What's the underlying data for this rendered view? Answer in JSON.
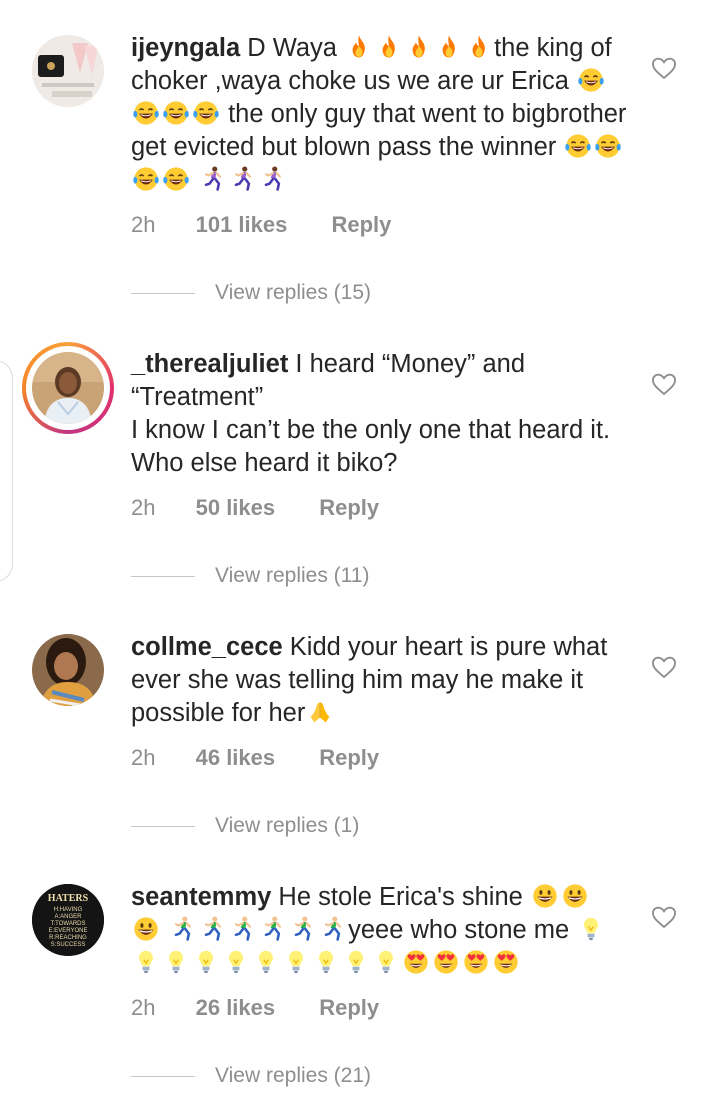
{
  "comments": [
    {
      "username": "ijeyngala",
      "segments": [
        {
          "t": "D Waya "
        },
        {
          "e": "fire"
        },
        {
          "e": "fire"
        },
        {
          "e": "fire"
        },
        {
          "e": "fire"
        },
        {
          "e": "fire"
        },
        {
          "t": "the king of choker ,waya choke us we are ur Erica "
        },
        {
          "e": "laugh"
        },
        {
          "e": "laugh"
        },
        {
          "e": "laugh"
        },
        {
          "e": "laugh"
        },
        {
          "t": " the only guy that went to bigbrother get evicted but blown pass the winner "
        },
        {
          "e": "laugh"
        },
        {
          "e": "laugh"
        },
        {
          "e": "laugh"
        },
        {
          "e": "laugh"
        },
        {
          "t": " "
        },
        {
          "e": "runner-f"
        },
        {
          "e": "runner-f"
        },
        {
          "e": "runner-f"
        }
      ],
      "time": "2h",
      "likes": "101 likes",
      "reply": "Reply",
      "view_replies": "View replies (15)"
    },
    {
      "username": "_therealjuliet",
      "segments": [
        {
          "t": "I heard “Money” and “Treatment”"
        },
        {
          "br": true
        },
        {
          "t": "I know I can’t be the only one that heard it. Who else heard it biko?"
        }
      ],
      "time": "2h",
      "likes": "50 likes",
      "reply": "Reply",
      "view_replies": "View replies (11)"
    },
    {
      "username": "collme_cece",
      "segments": [
        {
          "t": "Kidd your heart is pure what ever she was telling him may he make it possible for her"
        },
        {
          "e": "pray"
        }
      ],
      "time": "2h",
      "likes": "46 likes",
      "reply": "Reply",
      "view_replies": "View replies (1)"
    },
    {
      "username": "seantemmy",
      "segments": [
        {
          "t": "He stole Erica's shine "
        },
        {
          "e": "grin"
        },
        {
          "e": "grin"
        },
        {
          "br": true
        },
        {
          "e": "grin"
        },
        {
          "t": " "
        },
        {
          "e": "runner"
        },
        {
          "e": "runner"
        },
        {
          "e": "runner"
        },
        {
          "e": "runner"
        },
        {
          "e": "runner"
        },
        {
          "e": "runner"
        },
        {
          "t": "yeee who stone me "
        },
        {
          "e": "bulb"
        },
        {
          "e": "bulb"
        },
        {
          "e": "bulb"
        },
        {
          "e": "bulb"
        },
        {
          "e": "bulb"
        },
        {
          "e": "bulb"
        },
        {
          "e": "bulb"
        },
        {
          "e": "bulb"
        },
        {
          "e": "bulb"
        },
        {
          "e": "bulb"
        },
        {
          "e": "hearteyes"
        },
        {
          "e": "hearteyes"
        },
        {
          "e": "hearteyes"
        },
        {
          "e": "hearteyes"
        }
      ],
      "avatar_text": [
        "HATERS",
        "H:HAVING",
        "A:ANGER",
        "T:TOWARDS",
        "E:EVERYONE",
        "R:REACHING",
        "S:SUCCESS"
      ],
      "time": "2h",
      "likes": "26 likes",
      "reply": "Reply",
      "view_replies": "View replies (21)"
    }
  ],
  "colors": {
    "text": "#262626",
    "muted": "#8e8e8e",
    "story_ring": [
      "#f9a13a",
      "#e1306c",
      "#c13584"
    ]
  },
  "icons": {
    "like": "heart-outline-icon",
    "fire": "fire-emoji",
    "laugh": "tears-of-joy-emoji",
    "runner-f": "woman-running-emoji",
    "runner": "man-running-emoji",
    "pray": "folded-hands-emoji",
    "grin": "grinning-face-emoji",
    "bulb": "light-bulb-emoji",
    "hearteyes": "heart-eyes-emoji"
  }
}
